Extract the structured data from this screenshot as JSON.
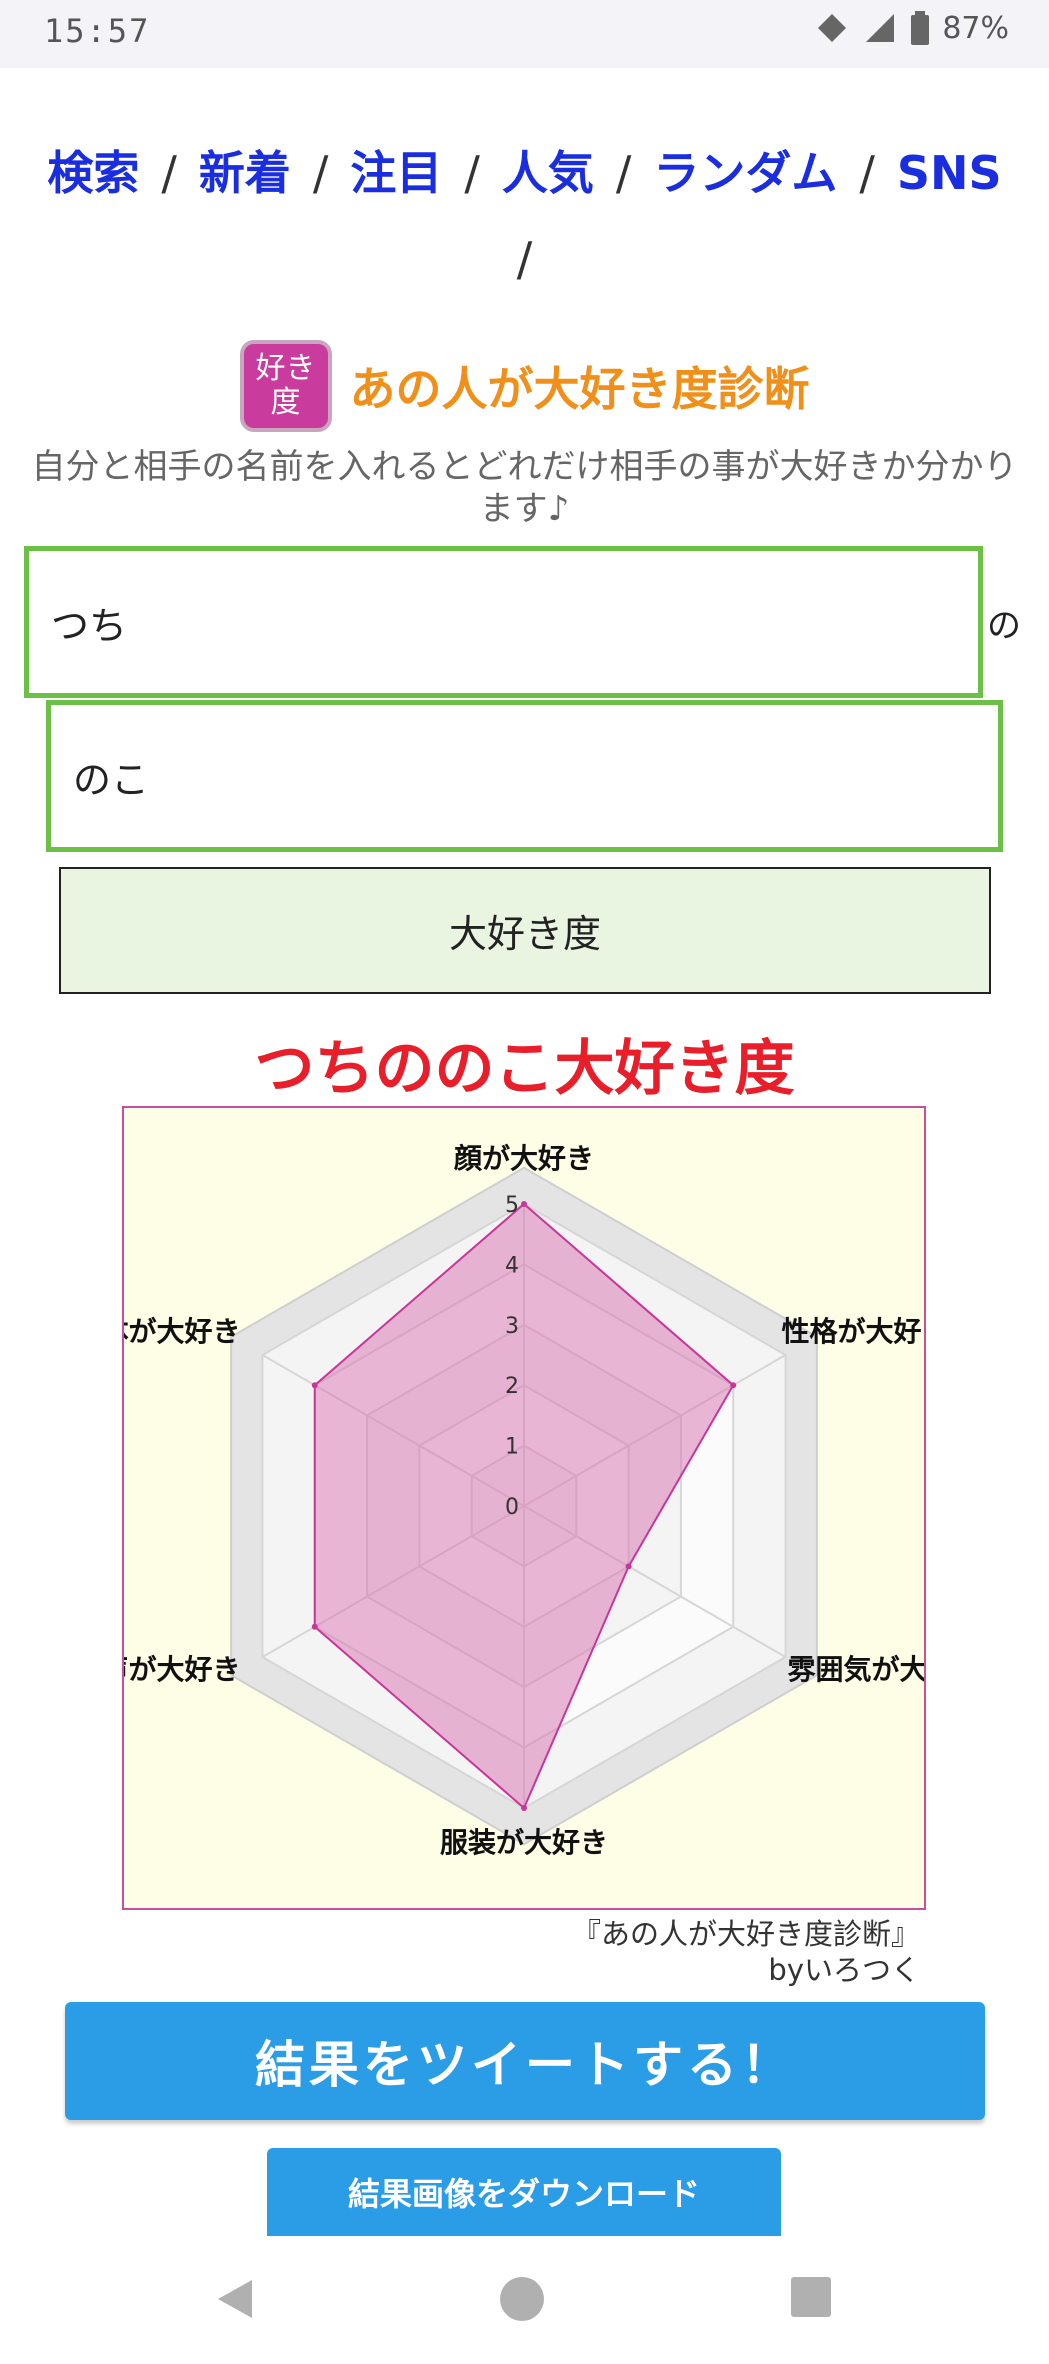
{
  "status_bar": {
    "time": "15:57",
    "battery": "87%"
  },
  "nav": {
    "links": [
      {
        "label": "検索"
      },
      {
        "label": "新着"
      },
      {
        "label": "注目"
      },
      {
        "label": "人気"
      },
      {
        "label": "ランダム"
      },
      {
        "label": "SNS"
      }
    ],
    "separator": "/"
  },
  "app": {
    "icon_text": "好き度",
    "title": "あの人が大好き度診断",
    "description": "自分と相手の名前を入れるとどれだけ相手の事が大好きか分かります♪"
  },
  "form": {
    "name1_value": "つち",
    "connector": "の",
    "name2_value": "のこ",
    "submit_label": "大好き度"
  },
  "result": {
    "title": "つちののこ大好き度",
    "credit_line1": "『あの人が大好き度診断』",
    "credit_line2": "byいろつく"
  },
  "chart_data": {
    "type": "radar",
    "categories": [
      "顔が大好き",
      "性格が大好き",
      "雰囲気が大好き",
      "服装が大好き",
      "声が大好き",
      "体が大好き"
    ],
    "values": [
      5,
      4,
      2,
      5,
      4,
      4
    ],
    "scale_ticks": [
      "0",
      "1",
      "2",
      "3",
      "4",
      "5"
    ],
    "rmax": 5,
    "colors": {
      "fill": "#d87bb5",
      "stroke": "#c9359a",
      "background": "#fefee6",
      "grid": "#d6d6d6"
    }
  },
  "actions": {
    "tweet_label": "結果をツイートする！",
    "download_label": "結果画像をダウンロード"
  }
}
